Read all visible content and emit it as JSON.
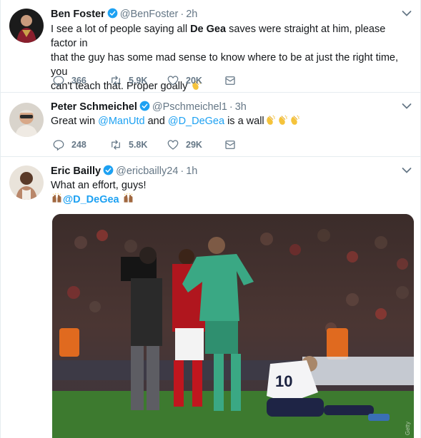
{
  "tweets": [
    {
      "name": "Ben Foster",
      "handle": "@BenFoster",
      "sep": "·",
      "time": "2h",
      "text_parts": [
        "I see a lot of people saying all ",
        "De Gea",
        " saves were straight at him, please factor in",
        "that the guy has some mad sense to know where to be at just the right time, you",
        "can't teach that. Proper goally "
      ],
      "emoji": "clapping-hands-emoji",
      "reply_count": "366",
      "retweet_count": "5.9K",
      "like_count": "20K"
    },
    {
      "name": "Peter Schmeichel",
      "handle": "@Pschmeichel1",
      "sep": "·",
      "time": "3h",
      "text_parts": [
        "Great win ",
        "@ManUtd",
        " and ",
        "@D_DeGea",
        " is a wall"
      ],
      "emoji": "clapping-hands-emoji",
      "reply_count": "248",
      "retweet_count": "5.8K",
      "like_count": "29K"
    },
    {
      "name": "Eric Bailly",
      "handle": "@ericbailly24",
      "sep": "·",
      "time": "1h",
      "text_line1": "What an effort, guys!",
      "mention": "@D_DeGea",
      "emoji": "raised-hands-emoji",
      "photo_watermark": "Getty"
    }
  ],
  "colors": {
    "accent": "#1da1f2",
    "muted": "#657786",
    "text": "#14171a",
    "clap": "#f5c33b",
    "raised_hands": "#a0673f"
  }
}
